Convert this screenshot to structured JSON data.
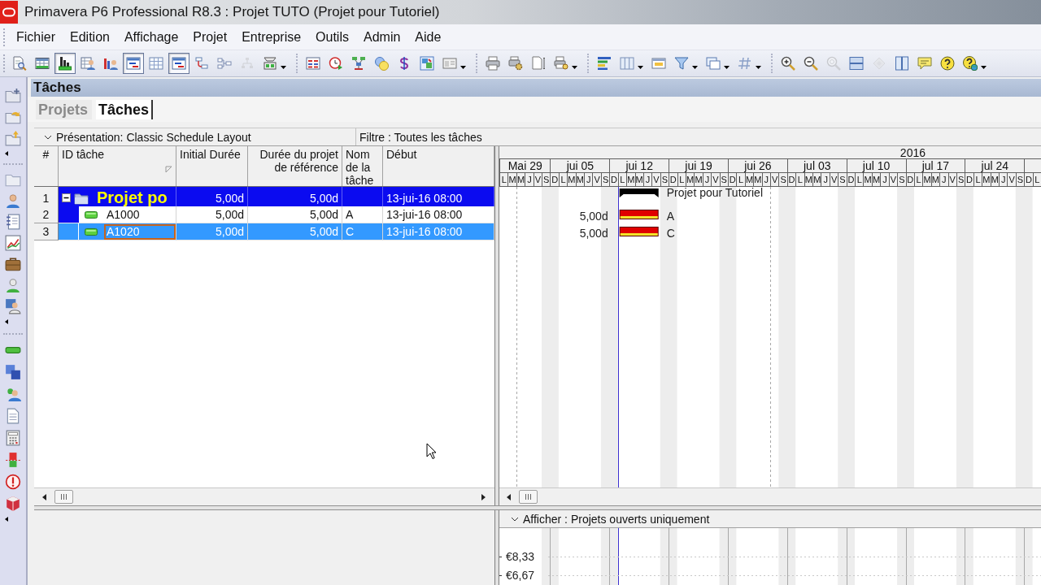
{
  "window": {
    "title": "Primavera P6 Professional R8.3 : Projet TUTO (Projet pour Tutoriel)"
  },
  "menu": [
    {
      "label": "Fichier"
    },
    {
      "label": "Edition"
    },
    {
      "label": "Affichage"
    },
    {
      "label": "Projet"
    },
    {
      "label": "Entreprise"
    },
    {
      "label": "Outils"
    },
    {
      "label": "Admin"
    },
    {
      "label": "Aide"
    }
  ],
  "toolbar": {
    "groups": [
      [
        {
          "pressed": false,
          "disabled": false,
          "dropdown": false
        },
        {
          "pressed": false,
          "disabled": false,
          "dropdown": false
        },
        {
          "pressed": true,
          "disabled": false,
          "dropdown": false
        },
        {
          "pressed": false,
          "disabled": false,
          "dropdown": false
        },
        {
          "pressed": false,
          "disabled": false,
          "dropdown": false
        },
        {
          "pressed": true,
          "disabled": false,
          "dropdown": false
        },
        {
          "pressed": false,
          "disabled": false,
          "dropdown": false
        },
        {
          "pressed": true,
          "disabled": false,
          "dropdown": false
        },
        {
          "pressed": false,
          "disabled": false,
          "dropdown": false
        },
        {
          "pressed": false,
          "disabled": false,
          "dropdown": false
        },
        {
          "pressed": false,
          "disabled": true,
          "dropdown": false
        },
        {
          "pressed": false,
          "disabled": false,
          "dropdown": true
        }
      ],
      [
        {
          "pressed": false,
          "disabled": false,
          "dropdown": false
        },
        {
          "pressed": false,
          "disabled": false,
          "dropdown": false
        },
        {
          "pressed": false,
          "disabled": false,
          "dropdown": false
        },
        {
          "pressed": false,
          "disabled": false,
          "dropdown": false
        },
        {
          "pressed": false,
          "disabled": false,
          "dropdown": false
        },
        {
          "pressed": false,
          "disabled": false,
          "dropdown": false
        },
        {
          "pressed": false,
          "disabled": false,
          "dropdown": true
        }
      ],
      [
        {
          "pressed": false,
          "disabled": false,
          "dropdown": false
        },
        {
          "pressed": false,
          "disabled": false,
          "dropdown": false
        },
        {
          "pressed": false,
          "disabled": false,
          "dropdown": false
        },
        {
          "pressed": false,
          "disabled": false,
          "dropdown": true
        }
      ],
      [
        {
          "pressed": false,
          "disabled": false,
          "dropdown": false
        },
        {
          "pressed": false,
          "disabled": false,
          "dropdown": true
        },
        {
          "pressed": false,
          "disabled": false,
          "dropdown": false
        },
        {
          "pressed": false,
          "disabled": false,
          "dropdown": true
        },
        {
          "pressed": false,
          "disabled": false,
          "dropdown": true
        },
        {
          "pressed": false,
          "disabled": false,
          "dropdown": true
        }
      ],
      [
        {
          "pressed": false,
          "disabled": false,
          "dropdown": false
        },
        {
          "pressed": false,
          "disabled": false,
          "dropdown": false
        },
        {
          "pressed": false,
          "disabled": true,
          "dropdown": false
        },
        {
          "pressed": false,
          "disabled": false,
          "dropdown": false
        },
        {
          "pressed": false,
          "disabled": true,
          "dropdown": false
        },
        {
          "pressed": false,
          "disabled": false,
          "dropdown": false
        },
        {
          "pressed": false,
          "disabled": false,
          "dropdown": false
        },
        {
          "pressed": false,
          "disabled": false,
          "dropdown": false
        },
        {
          "pressed": false,
          "disabled": false,
          "dropdown": true
        }
      ]
    ]
  },
  "panel": {
    "title": "Tâches"
  },
  "tabs": [
    {
      "label": "Projets",
      "selected": false
    },
    {
      "label": "Tâches",
      "selected": true
    }
  ],
  "layout_bar": {
    "presentation": "Présentation: Classic Schedule Layout",
    "filter": "Filtre : Toutes les tâches"
  },
  "table": {
    "columns": [
      "#",
      "ID tâche",
      "Initial Durée",
      "Durée du projet de référence",
      "Nom de la tâche",
      "Début"
    ],
    "rows": [
      {
        "kind": "project",
        "number": "1",
        "id": "Projet po",
        "initial_duration": "5,00d",
        "baseline_duration": "5,00d",
        "start": "13-jui-16 08:00",
        "expanded": true,
        "selected": false,
        "focused": false,
        "children": [
          {
            "kind": "task",
            "number": "2",
            "id": "A1000",
            "initial_duration": "5,00d",
            "baseline_duration": "5,00d",
            "name": "A",
            "start": "13-jui-16 08:00",
            "selected": false,
            "focused": false
          },
          {
            "kind": "task",
            "number": "3",
            "id": "A1020",
            "initial_duration": "5,00d",
            "baseline_duration": "5,00d",
            "name": "C",
            "start": "13-jui-16 08:00",
            "selected": true,
            "focused": true
          }
        ]
      }
    ]
  },
  "gantt": {
    "timescale": {
      "year": "2016",
      "weeks": [
        {
          "label": "Mai 29",
          "days": [
            "L",
            "M",
            "M",
            "J",
            "V",
            "S"
          ]
        },
        {
          "label": "jui 05",
          "days": [
            "D",
            "L",
            "M",
            "M",
            "J",
            "V",
            "S"
          ]
        },
        {
          "label": "jui 12",
          "days": [
            "D",
            "L",
            "M",
            "M",
            "J",
            "V",
            "S"
          ]
        },
        {
          "label": "jui 19",
          "days": [
            "D",
            "L",
            "M",
            "M",
            "J",
            "V",
            "S"
          ]
        },
        {
          "label": "jui 26",
          "days": [
            "D",
            "L",
            "M",
            "M",
            "J",
            "V",
            "S"
          ]
        },
        {
          "label": "jul 03",
          "days": [
            "D",
            "L",
            "M",
            "M",
            "J",
            "V",
            "S"
          ]
        },
        {
          "label": "jul 10",
          "days": [
            "D",
            "L",
            "M",
            "M",
            "J",
            "V",
            "S"
          ]
        },
        {
          "label": "jul 17",
          "days": [
            "D",
            "L",
            "M",
            "M",
            "J",
            "V",
            "S"
          ]
        },
        {
          "label": "jul 24",
          "days": [
            "D",
            "L",
            "M",
            "M",
            "J",
            "V",
            "S"
          ]
        },
        {
          "days": [
            "D",
            "L"
          ]
        }
      ]
    },
    "bars": [
      {
        "kind": "summary",
        "label": "Projet pour Tutoriel"
      },
      {
        "kind": "task",
        "duration": "5,00d",
        "label": "A"
      },
      {
        "kind": "task",
        "duration": "5,00d",
        "label": "C"
      }
    ]
  },
  "profile": {
    "display": "Afficher : Projets ouverts uniquement",
    "axis_labels": [
      "€8,33",
      "€6,67"
    ]
  }
}
